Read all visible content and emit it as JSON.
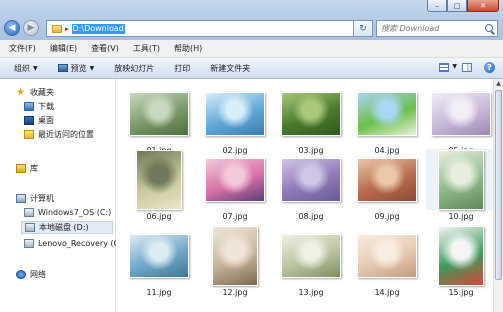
{
  "window": {
    "minimize": "–",
    "maximize": "□",
    "close": "✕"
  },
  "address": {
    "path": "D:\\Download"
  },
  "search": {
    "placeholder": "搜索 Download"
  },
  "menu": [
    "文件(F)",
    "编辑(E)",
    "查看(V)",
    "工具(T)",
    "帮助(H)"
  ],
  "commands": {
    "organize": "组织",
    "preview": "预览",
    "slideshow": "放映幻灯片",
    "print": "打印",
    "new_folder": "新建文件夹"
  },
  "nav": {
    "favorites": "收藏夹",
    "downloads": "下载",
    "desktop": "桌面",
    "recent": "最近访问的位置",
    "libraries": "库",
    "computer": "计算机",
    "drive_c": "Windows7_OS (C:)",
    "drive_d": "本地磁盘 (D:)",
    "drive_recovery": "Lenovo_Recovery (C",
    "network": "网络"
  },
  "files": [
    {
      "name": "01.jpg",
      "colors": [
        "#7c9a6a",
        "#c9d9c0",
        "#4d6e3c"
      ],
      "portrait": false
    },
    {
      "name": "02.jpg",
      "colors": [
        "#5fa9d9",
        "#d8eef8",
        "#3d7db0"
      ],
      "portrait": false
    },
    {
      "name": "03.jpg",
      "colors": [
        "#4a7a2e",
        "#a8c97a",
        "#2f5a1e"
      ],
      "portrait": false
    },
    {
      "name": "04.jpg",
      "colors": [
        "#6bbf4a",
        "#a9d6f2",
        "#e7f2d8"
      ],
      "portrait": false
    },
    {
      "name": "05.jpg",
      "colors": [
        "#c7b8d8",
        "#f2eef6",
        "#9d8ab5"
      ],
      "portrait": false
    },
    {
      "name": "06.jpg",
      "colors": [
        "#c9c89a",
        "#6f7a5a",
        "#e9e6c8"
      ],
      "portrait": true
    },
    {
      "name": "07.jpg",
      "colors": [
        "#d96fa8",
        "#f3c9da",
        "#5a3e7a"
      ],
      "portrait": false
    },
    {
      "name": "08.jpg",
      "colors": [
        "#8e7ab8",
        "#cfc6e6",
        "#6a5a99"
      ],
      "portrait": false
    },
    {
      "name": "09.jpg",
      "colors": [
        "#b86b4e",
        "#e9c7a8",
        "#8e4a36"
      ],
      "portrait": false
    },
    {
      "name": "10.jpg",
      "colors": [
        "#8fb98a",
        "#e8efe0",
        "#5e8a5a"
      ],
      "portrait": true
    },
    {
      "name": "11.jpg",
      "colors": [
        "#6fa8c9",
        "#dcecf2",
        "#3e7898"
      ],
      "portrait": false
    },
    {
      "name": "12.jpg",
      "colors": [
        "#c8b49a",
        "#f0e6d8",
        "#7e6a52"
      ],
      "portrait": true
    },
    {
      "name": "13.jpg",
      "colors": [
        "#b9c4a0",
        "#eef0e2",
        "#7f8f5e"
      ],
      "portrait": false
    },
    {
      "name": "14.jpg",
      "colors": [
        "#e6c9b0",
        "#f8ede2",
        "#c79a7e"
      ],
      "portrait": false
    },
    {
      "name": "15.jpg",
      "colors": [
        "#3a9a5a",
        "#f5f5f5",
        "#d94a3a"
      ],
      "portrait": true
    }
  ]
}
